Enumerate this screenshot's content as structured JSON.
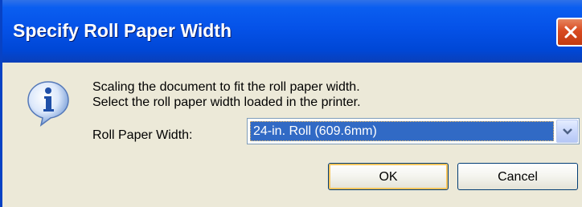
{
  "window": {
    "title": "Specify Roll Paper Width"
  },
  "icons": {
    "info": "info-icon",
    "close": "close-icon",
    "dropdown": "chevron-down-icon"
  },
  "message": {
    "line1": "Scaling the document to fit the roll paper width.",
    "line2": "Select the roll paper width loaded in the printer."
  },
  "roll_width": {
    "label": "Roll Paper Width:",
    "selected": "24-in. Roll (609.6mm)"
  },
  "buttons": {
    "ok": "OK",
    "cancel": "Cancel"
  },
  "colors": {
    "titlebar": "#0552e8",
    "dialog_bg": "#ece9d8",
    "selection": "#316ac5",
    "close_button": "#d84a20"
  }
}
